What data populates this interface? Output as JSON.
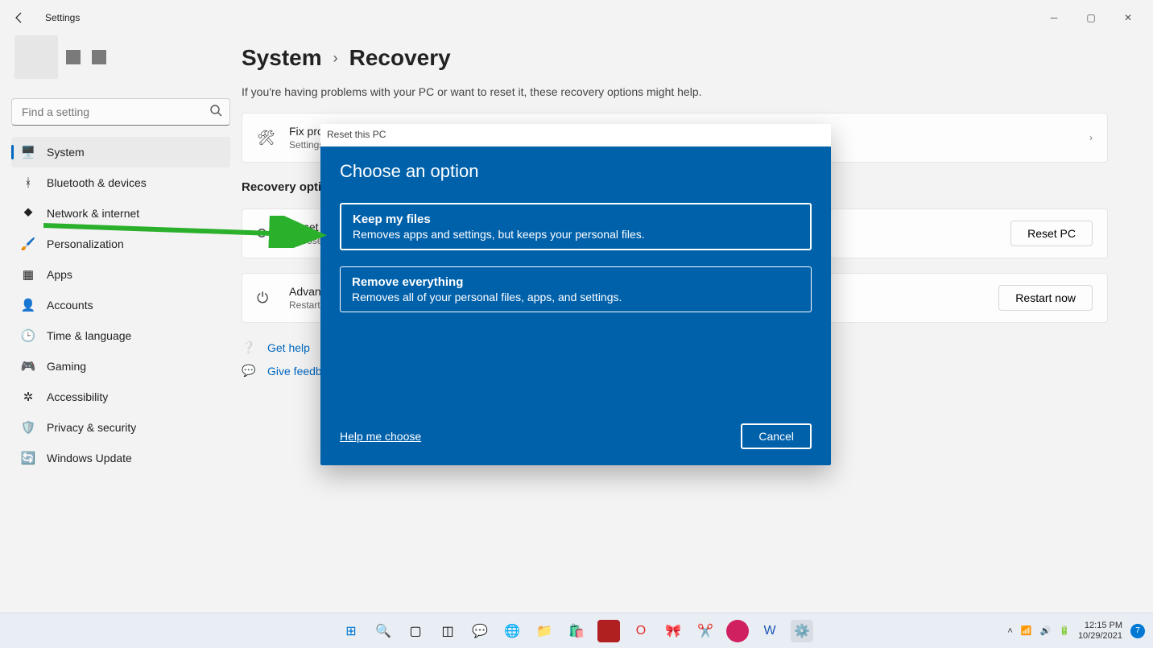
{
  "window": {
    "title": "Settings"
  },
  "search": {
    "placeholder": "Find a setting"
  },
  "sidebar": {
    "items": [
      {
        "icon": "🖥️",
        "label": "System",
        "active": true
      },
      {
        "icon": "ᚼ",
        "label": "Bluetooth & devices"
      },
      {
        "icon": "⯁",
        "label": "Network & internet"
      },
      {
        "icon": "🖌️",
        "label": "Personalization"
      },
      {
        "icon": "▦",
        "label": "Apps"
      },
      {
        "icon": "👤",
        "label": "Accounts"
      },
      {
        "icon": "🕒",
        "label": "Time & language"
      },
      {
        "icon": "🎮",
        "label": "Gaming"
      },
      {
        "icon": "✲",
        "label": "Accessibility"
      },
      {
        "icon": "🛡️",
        "label": "Privacy & security"
      },
      {
        "icon": "🔄",
        "label": "Windows Update"
      }
    ]
  },
  "breadcrumb": {
    "parent": "System",
    "current": "Recovery"
  },
  "intro": "If you're having problems with your PC or want to reset it, these recovery options might help.",
  "cards": {
    "fix": {
      "title": "Fix problems",
      "sub": "Settings"
    },
    "section": "Recovery options",
    "reset": {
      "title": "Reset this PC",
      "sub": "Choose to keep or remove your personal files, then reinstall Windows",
      "button": "Reset PC"
    },
    "advanced": {
      "title": "Advanced startup",
      "sub": "Restart your device to change startup settings, including starting from a disc or USB drive",
      "button": "Restart now"
    }
  },
  "links": {
    "help": "Get help",
    "feedback": "Give feedback"
  },
  "modal": {
    "titlebar": "Reset this PC",
    "heading": "Choose an option",
    "options": [
      {
        "title": "Keep my files",
        "sub": "Removes apps and settings, but keeps your personal files."
      },
      {
        "title": "Remove everything",
        "sub": "Removes all of your personal files, apps, and settings."
      }
    ],
    "help_link": "Help me choose",
    "cancel": "Cancel"
  },
  "taskbar": {
    "time": "12:15 PM",
    "date": "10/29/2021",
    "badge": "7"
  }
}
